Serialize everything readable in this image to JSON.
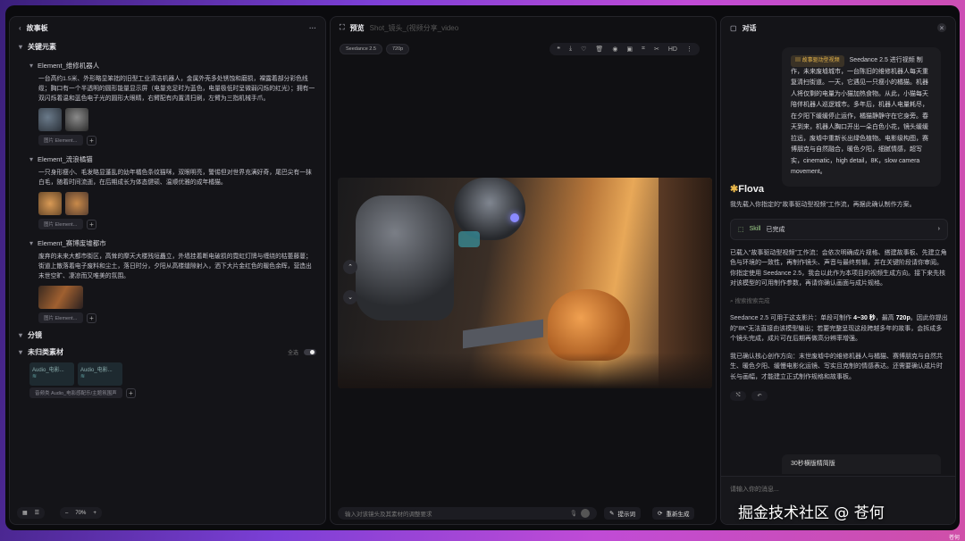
{
  "left": {
    "title": "故事板",
    "menu_icon": "more-horizontal",
    "key_elements": "关键元素",
    "elements": [
      {
        "name": "Element_维修机器人",
        "desc": "一台高约1.5米、外形略显笨拙的旧型工业清洁机器人，金属外壳多处锈蚀和磨损，裸露着部分彩色线缆；胸口有一个半透明的圆形能量显示屏（电量充足时为蓝色，电量极低时呈微弱闪烁的红光）；拥有一双闪烁着温和蓝色电子光的圆形大眼睛，右臂配有内置清扫刷，左臂为三指机械手爪。",
        "tag": "图片 Element..."
      },
      {
        "name": "Element_流浪橘猫",
        "desc": "一只身形瘦小、毛发略显蓬乱的幼年橘色条纹猫咪，双眼明亮，警惕但对世界充满好奇，尾巴尖有一抹白毛，随着时间流逝，在后期成长为体态健硕、温顺优雅的成年橘猫。",
        "tag": "图片 Element..."
      },
      {
        "name": "Element_赛博废墟都市",
        "desc": "废弃的未来大都市街区，高耸的摩天大楼残垣矗立，外墙挂着断电破损的霓虹灯牌与缠绕的枯萎藤蔓；街道上散落着电子废料和尘土，落日时分，夕阳从高楼缝隙射入，洒下大片金红色的暖色余晖，营造出末世空旷、凄凉而又唯美的氛围。",
        "tag": "图片 Element..."
      }
    ],
    "shots": "分镜",
    "unsorted": "未归类素材",
    "toggle_label": "全选",
    "audios": [
      "Audio_电影...",
      "Audio_电影..."
    ],
    "audio_tag": "音频类 Audio_电影感配乐/主题氛围声",
    "zoom": "70%"
  },
  "center": {
    "title": "预览",
    "file": "Shot_镜头_(视频分享_video",
    "model_chip": "Seedance 2.5",
    "res_chip": "720p",
    "hd": "HD",
    "input_placeholder": "输入对该镜头及其素材的调整要求",
    "prompt_btn": "提示词",
    "regen_btn": "重新生成"
  },
  "right": {
    "title": "对话",
    "bubble_tag": "故事驱动型视频",
    "bubble_head": "Seedance 2.5 进行视频",
    "bubble_body": "制作，未来废墟城市，一台陈旧的维修机器人每天重复清扫街道。一天，它遇见一只瘦小的橘猫。机器人将仅剩的电量为小猫加热食物。从此，小猫每天陪伴机器人巡逻城市。多年后，机器人电量耗尽，在夕阳下缓缓停止运作，橘猫静静守在它身旁。春天到来，机器人胸口开出一朵白色小花，镜头缓缓拉远，废墟中重新长出绿色植物。电影级构图，赛博朋克与自然融合，暖色夕阳，细腻情感，超写实，cinematic，high detail，8K，slow camera movement。",
    "brand": "Flova",
    "p1": "我先载入你指定的“故事驱动型视频”工作流，再据此确认制作方案。",
    "skill_label": "Skill",
    "skill_status": "已完成",
    "p2": "已载入“故事驱动型视频”工作流：会依次明确成片规格、搭建故事板、先建立角色与环境的一致性，再制作镜头、声音与最终剪辑，并在关键阶段请你审阅。你指定使用 Seedance 2.5，我会以此作为本项目的视频生成方向。接下来先核对该模型的可用制作参数，再请你确认画面与成片规格。",
    "search_note": "搜索搜索完成",
    "p3a": "Seedance 2.5 可用于这支影片：单段可制作 ",
    "p3b": "4~30 秒",
    "p3c": "，最高 ",
    "p3d": "720p",
    "p3e": "。因此你提出的“8K”无法直接由该模型输出；若要完整呈现这段跨越多年的故事，会拆成多个镜头完成，成片可在后期再做高分辨率增强。",
    "p4": "我已确认核心创作方向：末世废墟中的维修机器人与橘猫、赛博朋克与自然共生、暖色夕阳、缓慢电影化运镜、写实且克制的情感表达。还需要确认成片时长与画幅，才能建立正式制作规格和故事板。",
    "bubble2_head": "30秒横版精简版",
    "input_placeholder": "请输入你的消息...",
    "watermark": "掘金技术社区 @ 苍何",
    "corner": "苍何"
  },
  "colors": {
    "accent": "#7c3fd6",
    "panel": "#141418",
    "gold": "#e8b64a",
    "skill": "#9fd08a"
  }
}
